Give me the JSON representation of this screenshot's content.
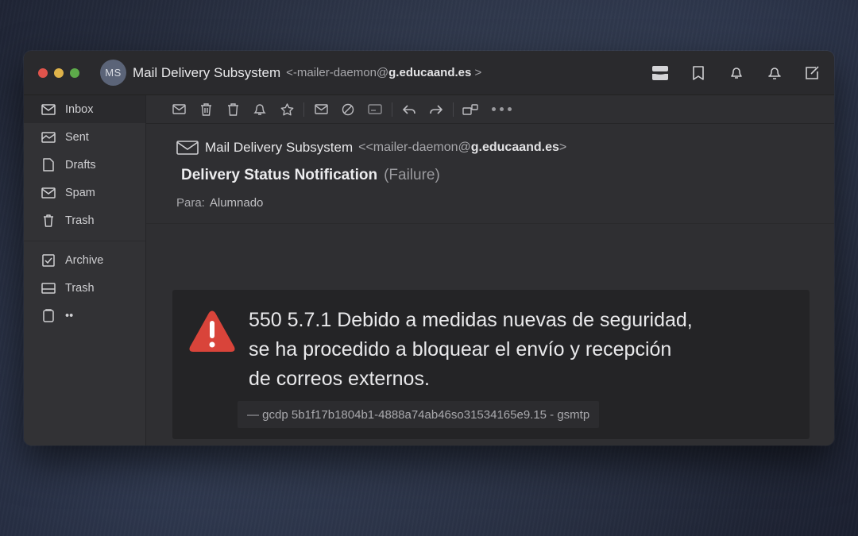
{
  "window": {
    "avatar_initials": "MS",
    "sender_name": "Mail Delivery Subsystem",
    "address_prefix": "<-mailer-daemon@",
    "address_domain": "g.educaand.es",
    "address_suffix": " >"
  },
  "titlebar_icons": [
    "panel-icon",
    "bookmark-icon",
    "bell-icon",
    "notification-icon",
    "compose-icon"
  ],
  "sidebar": {
    "items": [
      {
        "label": "Inbox",
        "icon": "envelope-icon",
        "active": true
      },
      {
        "label": "Sent",
        "icon": "sent-tray-icon"
      },
      {
        "label": "Drafts",
        "icon": "document-icon"
      },
      {
        "label": "Spam",
        "icon": "spam-envelope-icon"
      },
      {
        "label": "Trash",
        "icon": "trash-icon"
      }
    ],
    "secondary": [
      {
        "label": "Archive",
        "icon": "archive-icon"
      },
      {
        "label": "Trash",
        "icon": "tray-icon"
      },
      {
        "label": "••",
        "icon": "clipboard-icon"
      }
    ]
  },
  "toolbar_icons": [
    "envelope-icon",
    "archive-box-icon",
    "delete-icon",
    "bell-icon",
    "star-icon",
    "mail-icon",
    "block-icon",
    "label-icon",
    "reply-icon",
    "forward-icon",
    "move-icon",
    "more-icon"
  ],
  "message": {
    "from_name": "Mail Delivery Subsystem",
    "from_prefix": "<<mailer-daemon@",
    "from_domain": "g.educaand.es",
    "from_suffix": ">",
    "subject": "Delivery Status Notification",
    "status": "(Failure)",
    "to_label": "Para:",
    "to_value": "Alumnado"
  },
  "error": {
    "line1": "550 5.7.1 Debido a medidas nuevas de seguridad,",
    "line2": "se ha procedido a bloquear el envío y recepción",
    "line3": "de correos externos.",
    "smtp_trace": "— gcdp  5b1f17b1804b1-4888a74ab46so31534165e9.15 - gsmtp"
  },
  "colors": {
    "error_red": "#d9443a",
    "background": "#2b2b2e"
  }
}
